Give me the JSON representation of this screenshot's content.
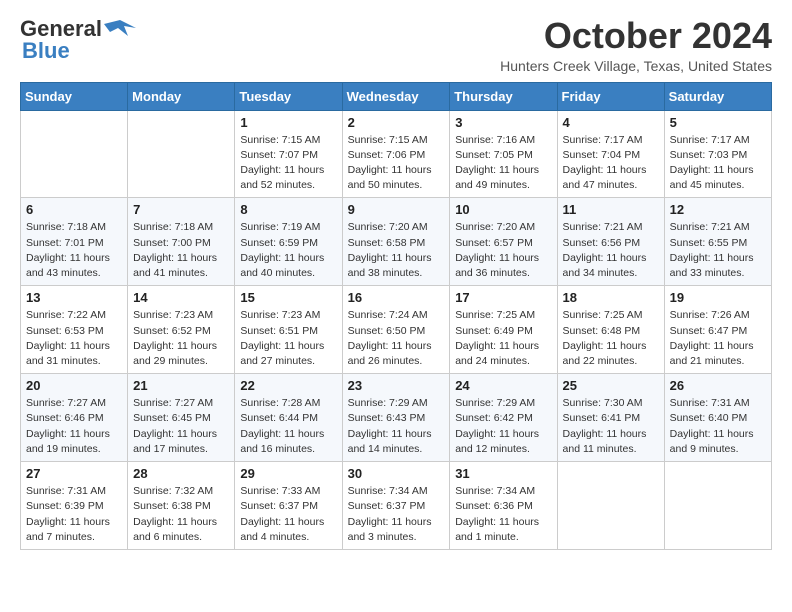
{
  "header": {
    "logo_line1": "General",
    "logo_line2": "Blue",
    "month": "October 2024",
    "location": "Hunters Creek Village, Texas, United States"
  },
  "weekdays": [
    "Sunday",
    "Monday",
    "Tuesday",
    "Wednesday",
    "Thursday",
    "Friday",
    "Saturday"
  ],
  "weeks": [
    [
      {
        "day": "",
        "info": ""
      },
      {
        "day": "",
        "info": ""
      },
      {
        "day": "1",
        "info": "Sunrise: 7:15 AM\nSunset: 7:07 PM\nDaylight: 11 hours and 52 minutes."
      },
      {
        "day": "2",
        "info": "Sunrise: 7:15 AM\nSunset: 7:06 PM\nDaylight: 11 hours and 50 minutes."
      },
      {
        "day": "3",
        "info": "Sunrise: 7:16 AM\nSunset: 7:05 PM\nDaylight: 11 hours and 49 minutes."
      },
      {
        "day": "4",
        "info": "Sunrise: 7:17 AM\nSunset: 7:04 PM\nDaylight: 11 hours and 47 minutes."
      },
      {
        "day": "5",
        "info": "Sunrise: 7:17 AM\nSunset: 7:03 PM\nDaylight: 11 hours and 45 minutes."
      }
    ],
    [
      {
        "day": "6",
        "info": "Sunrise: 7:18 AM\nSunset: 7:01 PM\nDaylight: 11 hours and 43 minutes."
      },
      {
        "day": "7",
        "info": "Sunrise: 7:18 AM\nSunset: 7:00 PM\nDaylight: 11 hours and 41 minutes."
      },
      {
        "day": "8",
        "info": "Sunrise: 7:19 AM\nSunset: 6:59 PM\nDaylight: 11 hours and 40 minutes."
      },
      {
        "day": "9",
        "info": "Sunrise: 7:20 AM\nSunset: 6:58 PM\nDaylight: 11 hours and 38 minutes."
      },
      {
        "day": "10",
        "info": "Sunrise: 7:20 AM\nSunset: 6:57 PM\nDaylight: 11 hours and 36 minutes."
      },
      {
        "day": "11",
        "info": "Sunrise: 7:21 AM\nSunset: 6:56 PM\nDaylight: 11 hours and 34 minutes."
      },
      {
        "day": "12",
        "info": "Sunrise: 7:21 AM\nSunset: 6:55 PM\nDaylight: 11 hours and 33 minutes."
      }
    ],
    [
      {
        "day": "13",
        "info": "Sunrise: 7:22 AM\nSunset: 6:53 PM\nDaylight: 11 hours and 31 minutes."
      },
      {
        "day": "14",
        "info": "Sunrise: 7:23 AM\nSunset: 6:52 PM\nDaylight: 11 hours and 29 minutes."
      },
      {
        "day": "15",
        "info": "Sunrise: 7:23 AM\nSunset: 6:51 PM\nDaylight: 11 hours and 27 minutes."
      },
      {
        "day": "16",
        "info": "Sunrise: 7:24 AM\nSunset: 6:50 PM\nDaylight: 11 hours and 26 minutes."
      },
      {
        "day": "17",
        "info": "Sunrise: 7:25 AM\nSunset: 6:49 PM\nDaylight: 11 hours and 24 minutes."
      },
      {
        "day": "18",
        "info": "Sunrise: 7:25 AM\nSunset: 6:48 PM\nDaylight: 11 hours and 22 minutes."
      },
      {
        "day": "19",
        "info": "Sunrise: 7:26 AM\nSunset: 6:47 PM\nDaylight: 11 hours and 21 minutes."
      }
    ],
    [
      {
        "day": "20",
        "info": "Sunrise: 7:27 AM\nSunset: 6:46 PM\nDaylight: 11 hours and 19 minutes."
      },
      {
        "day": "21",
        "info": "Sunrise: 7:27 AM\nSunset: 6:45 PM\nDaylight: 11 hours and 17 minutes."
      },
      {
        "day": "22",
        "info": "Sunrise: 7:28 AM\nSunset: 6:44 PM\nDaylight: 11 hours and 16 minutes."
      },
      {
        "day": "23",
        "info": "Sunrise: 7:29 AM\nSunset: 6:43 PM\nDaylight: 11 hours and 14 minutes."
      },
      {
        "day": "24",
        "info": "Sunrise: 7:29 AM\nSunset: 6:42 PM\nDaylight: 11 hours and 12 minutes."
      },
      {
        "day": "25",
        "info": "Sunrise: 7:30 AM\nSunset: 6:41 PM\nDaylight: 11 hours and 11 minutes."
      },
      {
        "day": "26",
        "info": "Sunrise: 7:31 AM\nSunset: 6:40 PM\nDaylight: 11 hours and 9 minutes."
      }
    ],
    [
      {
        "day": "27",
        "info": "Sunrise: 7:31 AM\nSunset: 6:39 PM\nDaylight: 11 hours and 7 minutes."
      },
      {
        "day": "28",
        "info": "Sunrise: 7:32 AM\nSunset: 6:38 PM\nDaylight: 11 hours and 6 minutes."
      },
      {
        "day": "29",
        "info": "Sunrise: 7:33 AM\nSunset: 6:37 PM\nDaylight: 11 hours and 4 minutes."
      },
      {
        "day": "30",
        "info": "Sunrise: 7:34 AM\nSunset: 6:37 PM\nDaylight: 11 hours and 3 minutes."
      },
      {
        "day": "31",
        "info": "Sunrise: 7:34 AM\nSunset: 6:36 PM\nDaylight: 11 hours and 1 minute."
      },
      {
        "day": "",
        "info": ""
      },
      {
        "day": "",
        "info": ""
      }
    ]
  ]
}
